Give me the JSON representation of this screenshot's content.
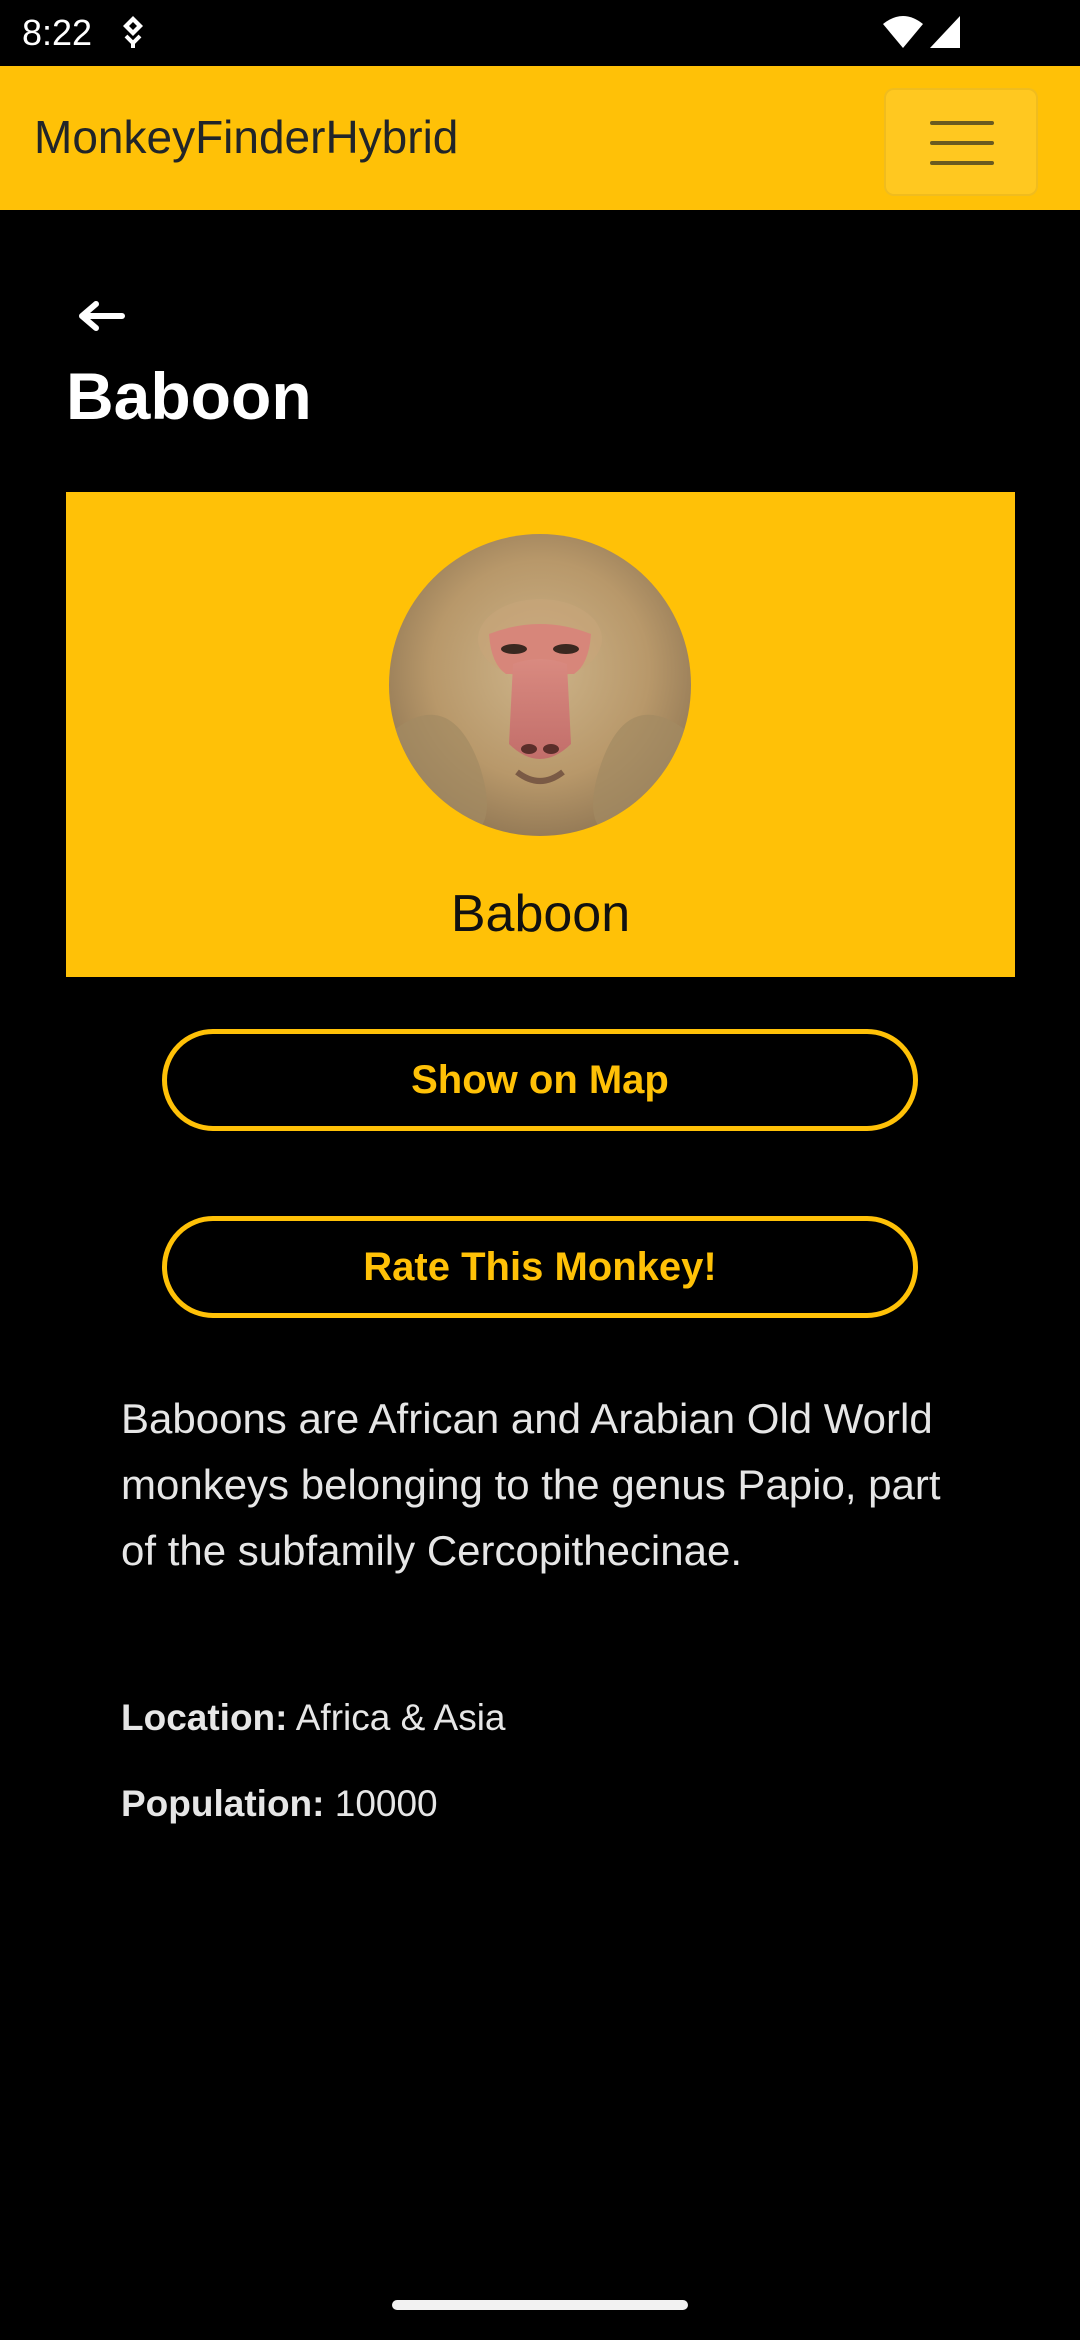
{
  "status_bar": {
    "time": "8:22",
    "icons": [
      "usb-debug-icon",
      "wifi-icon",
      "cell-signal-icon"
    ]
  },
  "app_bar": {
    "title": "MonkeyFinderHybrid",
    "menu_icon": "hamburger-menu-icon",
    "background_color": "#ffc107"
  },
  "page": {
    "back_icon": "back-arrow-icon",
    "title": "Baboon"
  },
  "card": {
    "image_subject": "baboon-face",
    "name": "Baboon"
  },
  "buttons": {
    "show_on_map": "Show on Map",
    "rate": "Rate This Monkey!"
  },
  "details": {
    "description": "Baboons are African and Arabian Old World monkeys belonging to the genus Papio, part of the subfamily Cercopithecinae.",
    "location_label": "Location:",
    "location_value": "Africa & Asia",
    "population_label": "Population:",
    "population_value": "10000"
  },
  "colors": {
    "accent": "#ffc107",
    "background": "#000000",
    "text": "#ffffff"
  }
}
